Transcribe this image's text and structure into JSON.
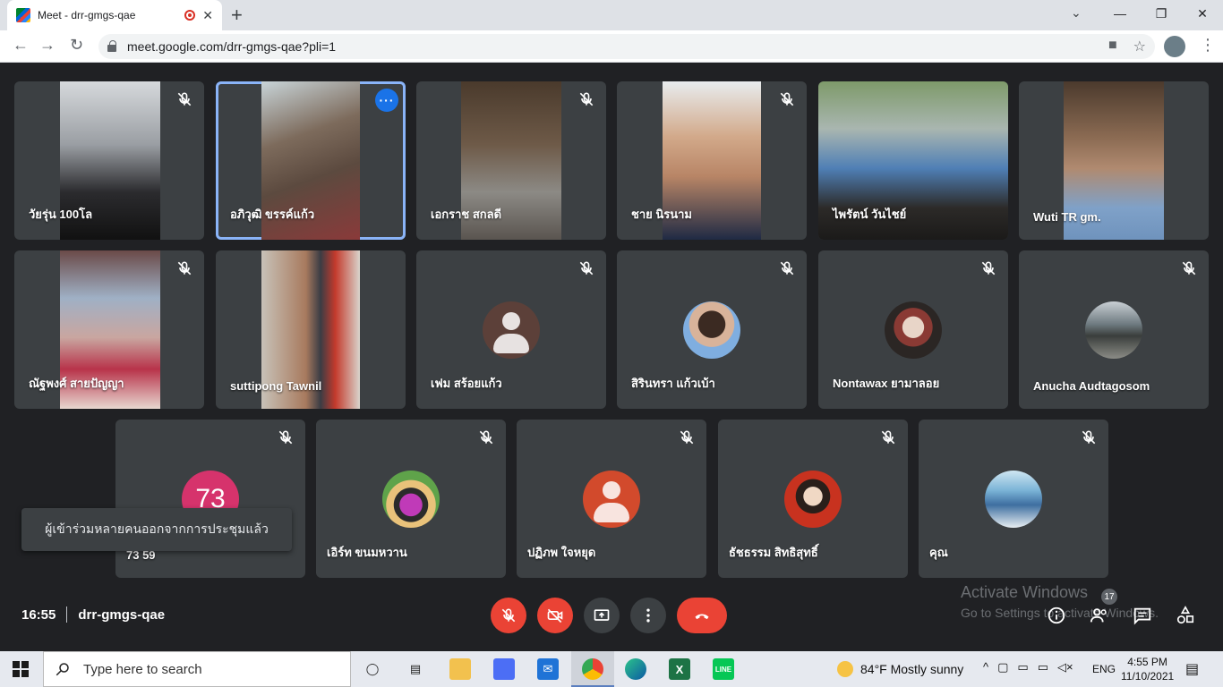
{
  "browser": {
    "tab_title": "Meet - drr-gmgs-qae",
    "tab_close": "✕",
    "new_tab": "+",
    "url": "meet.google.com/drr-gmgs-qae?pli=1"
  },
  "participants": [
    {
      "name": "วัยรุ่น 100โล",
      "muted": true
    },
    {
      "name": "อภิวุฒิ ขรรค์แก้ว",
      "muted": false,
      "active": true
    },
    {
      "name": "เอกราช สกลดี",
      "muted": true
    },
    {
      "name": "ชาย นิรนาม",
      "muted": true
    },
    {
      "name": "ไพรัตน์ วันไชย์",
      "muted": false
    },
    {
      "name": "Wuti TR gm.",
      "muted": false
    },
    {
      "name": "ณัฐพงศ์ สายปัญญา",
      "muted": true
    },
    {
      "name": "suttipong Tawnil",
      "muted": false
    },
    {
      "name": "เฟม สร้อยแก้ว",
      "muted": true
    },
    {
      "name": "สิรินทรา แก้วเบ้า",
      "muted": true
    },
    {
      "name": "Nontawax ยามาลอย",
      "muted": true
    },
    {
      "name": "Anucha Audtagosom",
      "muted": true
    },
    {
      "name": "73 59",
      "muted": true,
      "initials": "73"
    },
    {
      "name": "เอิร์ท ขนมหวาน",
      "muted": true
    },
    {
      "name": "ปฏิภพ ใจหยุด",
      "muted": true
    },
    {
      "name": "ธัชธรรม สิทธิสุทธิ์",
      "muted": true
    },
    {
      "name": "คุณ",
      "muted": true
    }
  ],
  "toast": "ผู้เข้าร่วมหลายคนออกจากการประชุมแล้ว",
  "meeting": {
    "time": "16:55",
    "code": "drr-gmgs-qae",
    "participant_count": "17"
  },
  "watermark": {
    "line1": "Activate Windows",
    "line2": "Go to Settings to activate Windows."
  },
  "taskbar": {
    "search_placeholder": "Type here to search",
    "weather": "84°F  Mostly sunny",
    "language": "ENG",
    "time": "4:55 PM",
    "date": "11/10/2021"
  },
  "colors": {
    "hangup": "#ea4335",
    "active_border": "#8ab4f8",
    "more_button": "#1a73e8"
  }
}
